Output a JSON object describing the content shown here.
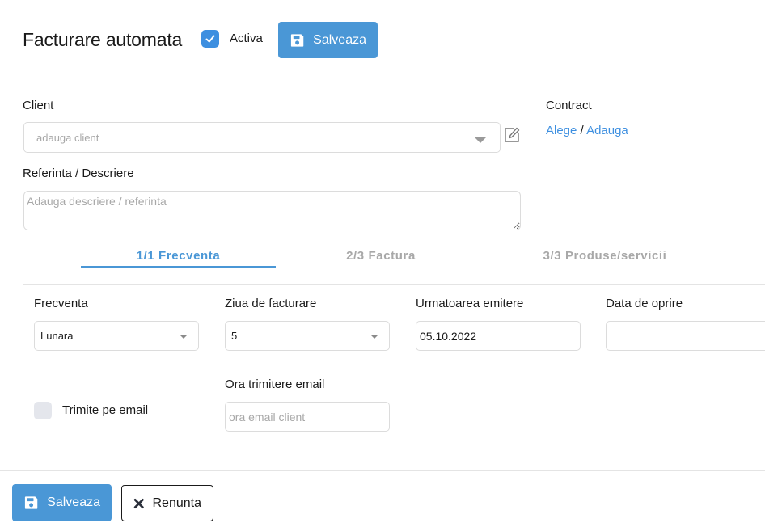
{
  "header": {
    "title": "Facturare automata",
    "active_label": "Activa",
    "active_checked": true,
    "save_label": "Salveaza"
  },
  "client": {
    "label": "Client",
    "placeholder": "adauga client"
  },
  "contract": {
    "label": "Contract",
    "choose_label": "Alege",
    "separator": "/",
    "add_label": "Adauga"
  },
  "reference": {
    "label": "Referinta / Descriere",
    "placeholder": "Adauga descriere / referinta"
  },
  "tabs": [
    {
      "label": "1/1 Frecventa",
      "active": true
    },
    {
      "label": "2/3 Factura",
      "active": false
    },
    {
      "label": "3/3 Produse/servicii",
      "active": false
    }
  ],
  "fields": {
    "frequency": {
      "label": "Frecventa",
      "value": "Lunara"
    },
    "billing_day": {
      "label": "Ziua de facturare",
      "value": "5"
    },
    "next_issue": {
      "label": "Urmatoarea emitere",
      "value": "05.10.2022"
    },
    "stop_date": {
      "label": "Data de oprire",
      "value": ""
    },
    "send_email": {
      "label": "Trimite pe email",
      "checked": false
    },
    "email_time": {
      "label": "Ora trimitere email",
      "placeholder": "ora email client"
    }
  },
  "footer": {
    "save_label": "Salveaza",
    "cancel_label": "Renunta"
  },
  "colors": {
    "accent": "#4a97d6",
    "link": "#3d8fe0"
  }
}
